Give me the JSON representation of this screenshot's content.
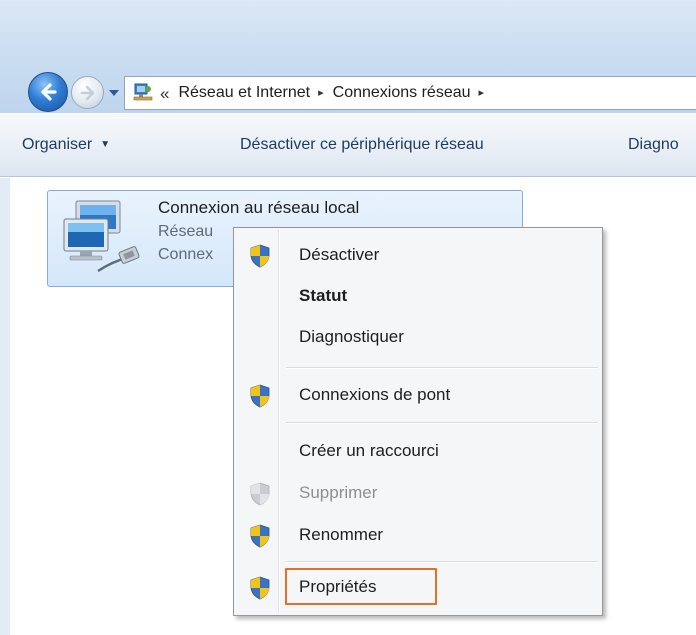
{
  "address_bar": {
    "overflow": "«",
    "crumbs": [
      "Réseau et Internet",
      "Connexions réseau"
    ],
    "separator": "▸"
  },
  "toolbar": {
    "organize": "Organiser",
    "disable_device": "Désactiver ce périphérique réseau",
    "diagnose": "Diagno"
  },
  "connection": {
    "name": "Connexion au réseau local",
    "line2": "Réseau",
    "line3": "Connex"
  },
  "context_menu": {
    "items": [
      {
        "label": "Désactiver",
        "icon": "uac-shield-icon"
      },
      {
        "label": "Statut",
        "bold": true
      },
      {
        "label": "Diagnostiquer"
      },
      {
        "label": "Connexions de pont",
        "icon": "uac-shield-icon"
      },
      {
        "label": "Créer un raccourci"
      },
      {
        "label": "Supprimer",
        "icon": "uac-shield-icon",
        "disabled": true
      },
      {
        "label": "Renommer",
        "icon": "uac-shield-icon"
      },
      {
        "label": "Propriétés",
        "icon": "uac-shield-icon",
        "highlighted": true
      }
    ],
    "highlight_color": "#e0702a"
  }
}
